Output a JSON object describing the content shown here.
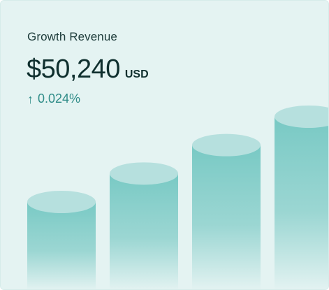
{
  "card": {
    "title": "Growth Revenue",
    "amount": "$50,240",
    "currency": "USD",
    "change": "0.024%",
    "change_icon": "arrow-up-icon"
  },
  "colors": {
    "background": "#e4f3f2",
    "bar_top": "#b6e0de",
    "bar_body": "#78c9c4",
    "accent": "#2f8c88",
    "text": "#0f2f2e"
  },
  "chart_data": {
    "type": "bar",
    "values": [
      3,
      4,
      5,
      6
    ],
    "ylim": [
      0,
      6.5
    ],
    "grid": false
  }
}
